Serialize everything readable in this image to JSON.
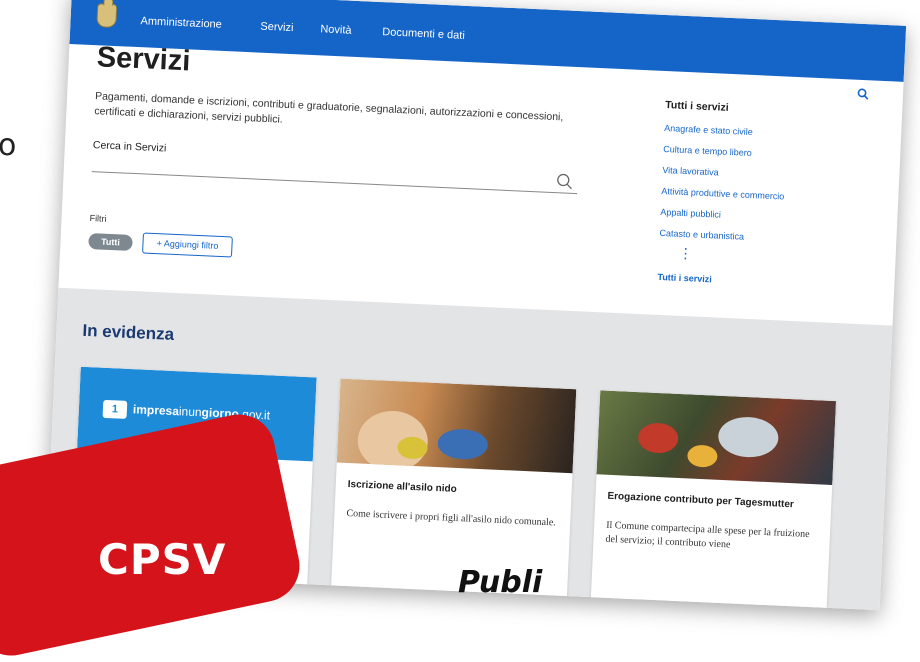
{
  "edge_text": "o",
  "topbar": {
    "nav": [
      "Amministrazione",
      "Servizi",
      "Novità",
      "Documenti e dati"
    ],
    "search_label": "Cerca"
  },
  "header": {
    "title": "Servizi",
    "description": "Pagamenti, domande e iscrizioni, contributi e graduatorie, segnalazioni, autorizzazioni e concessioni, certificati e dichiarazioni, servizi pubblici."
  },
  "search": {
    "label": "Cerca in Servizi"
  },
  "filters": {
    "label": "Filtri",
    "active_chip": "Tutti",
    "add_label": "+ Aggiungi filtro"
  },
  "sidebar": {
    "title": "Tutti i servizi",
    "links": [
      "Anagrafe e stato civile",
      "Cultura e tempo libero",
      "Vita lavorativa",
      "Attività produttive e commercio",
      "Appalti pubblici",
      "Catasto e urbanistica"
    ],
    "dots": "⋮",
    "more": "Tutti i servizi"
  },
  "highlights": {
    "heading": "In evidenza",
    "cards": [
      {
        "brand_strong": "impresa",
        "brand_mid": "inun",
        "brand_strong2": "giorno",
        "brand_tail": ".gov.it",
        "logo_mark": "1"
      },
      {
        "title": "Iscrizione all'asilo nido",
        "text": "Come iscrivere i propri figli all'asilo nido comunale."
      },
      {
        "title": "Erogazione contributo per Tagesmutter",
        "text": "Il Comune compartecipa alle spese per la fruizione del servizio; il contributo viene"
      }
    ]
  },
  "overlay": {
    "badge_text": "CPSV",
    "bottom_text": "Publi"
  },
  "colors": {
    "brand_blue": "#1565c8",
    "badge_red": "#d4131a",
    "section_gray": "#e3e4e6"
  }
}
